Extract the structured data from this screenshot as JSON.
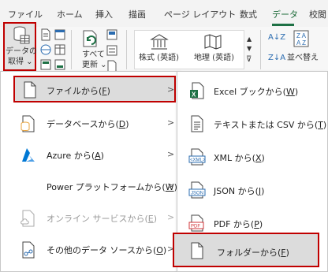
{
  "tabs": [
    {
      "label": "ファイル"
    },
    {
      "label": "ホーム"
    },
    {
      "label": "挿入"
    },
    {
      "label": "描画"
    },
    {
      "label": "ページ レイアウト"
    },
    {
      "label": "数式"
    },
    {
      "label": "データ"
    },
    {
      "label": "校閲"
    }
  ],
  "ribbon": {
    "get_data_line1": "データの",
    "get_data_line2": "取得 ⌄",
    "refresh_line1": "すべて",
    "refresh_line2": "更新 ⌄",
    "stocks": "株式 (英語)",
    "geography": "地理 (英語)",
    "sort_label": "並べ替え"
  },
  "menu": {
    "items": [
      {
        "label": "ファイルから(",
        "key": "F",
        "suffix": ")",
        "icon": "file-icon",
        "disabled": false,
        "has_submenu": true
      },
      {
        "label": "データベースから(",
        "key": "D",
        "suffix": ")",
        "icon": "database-icon",
        "disabled": false,
        "has_submenu": true
      },
      {
        "label": "Azure から(",
        "key": "A",
        "suffix": ")",
        "icon": "azure-icon",
        "disabled": false,
        "has_submenu": true
      },
      {
        "label": "Power プラットフォームから(",
        "key": "W",
        "suffix": ")",
        "icon": "",
        "disabled": false,
        "has_submenu": true
      },
      {
        "label": "オンライン サービスから(",
        "key": "E",
        "suffix": ")",
        "icon": "cloud-file-icon",
        "disabled": true,
        "has_submenu": true
      },
      {
        "label": "その他のデータ ソースから(",
        "key": "O",
        "suffix": ")",
        "icon": "other-sources-icon",
        "disabled": false,
        "has_submenu": true
      }
    ],
    "arrow": ">"
  },
  "submenu": {
    "items": [
      {
        "label": "Excel ブックから(",
        "key": "W",
        "suffix": ")",
        "icon": "excel-workbook-icon"
      },
      {
        "label": "テキストまたは CSV から(",
        "key": "T",
        "suffix": ")",
        "icon": "text-csv-icon"
      },
      {
        "label": "XML から(",
        "key": "X",
        "suffix": ")",
        "icon": "xml-icon"
      },
      {
        "label": "JSON から(",
        "key": "J",
        "suffix": ")",
        "icon": "json-icon"
      },
      {
        "label": "PDF から(",
        "key": "P",
        "suffix": ")",
        "icon": "pdf-icon"
      },
      {
        "label": "フォルダーから(",
        "key": "F",
        "suffix": ")",
        "icon": "folder-file-icon"
      }
    ]
  },
  "icon_text": {
    "xml": "<XML>",
    "json": "JSON",
    "pdf": "PDF"
  },
  "colors": {
    "highlight_border": "#c00000",
    "excel_green": "#1e7145",
    "azure_blue": "#0078d4",
    "pdf_red": "#d13438",
    "icon_blue": "#2b6cb0"
  }
}
